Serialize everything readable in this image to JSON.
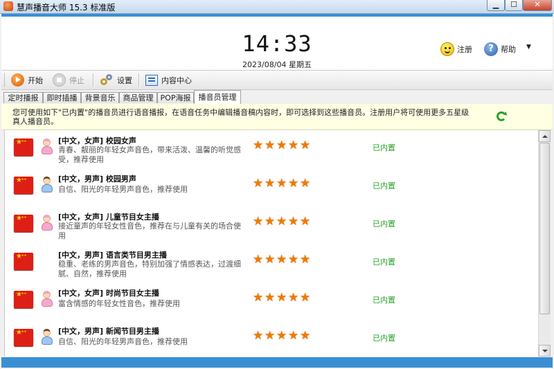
{
  "window": {
    "title": "慧声播音大师 15.3 标准版",
    "min": "▁",
    "max": "☐",
    "close": "✕"
  },
  "header": {
    "time": "14:33",
    "date": "2023/08/04 星期五",
    "register_label": "注册",
    "help_label": "帮助",
    "caret": "▼"
  },
  "toolbar": {
    "start_label": "开始",
    "stop_label": "停止",
    "settings_label": "设置",
    "content_label": "内容中心"
  },
  "tabs": [
    {
      "label": "定时播报"
    },
    {
      "label": "即时插播"
    },
    {
      "label": "背景音乐"
    },
    {
      "label": "商品管理"
    },
    {
      "label": "POP海报"
    },
    {
      "label": "播音员管理",
      "active": true
    }
  ],
  "notice": {
    "text": "您可使用如下\"已内置\"的播音员进行语音播报，在语音任务中编辑播音稿内容时，即可选择到这些播音员。注册用户将可使用更多五星级真人播音员。"
  },
  "announcers": [
    {
      "title": "[中文，女声] 校园女声",
      "desc": "青春、靓丽的年轻女声音色，带来活泼、温馨的听觉感受，推荐使用",
      "gender": "female",
      "rating": 5,
      "status": "已内置"
    },
    {
      "title": "[中文，男声] 校园男声",
      "desc": "自信、阳光的年轻男声音色，推荐使用",
      "gender": "male",
      "rating": 5,
      "status": "已内置"
    },
    {
      "title": "[中文，女声] 儿童节目女主播",
      "desc": "接近童声的年轻女性音色，推荐在与儿童有关的场合使用",
      "gender": "female",
      "rating": 5,
      "status": "已内置"
    },
    {
      "title": "[中文，男声] 语言类节目男主播",
      "desc": "稳重、老练的男声音色，特别加强了情感表达，过渡细腻、自然，推荐使用",
      "gender": "none",
      "rating": 5,
      "status": "已内置"
    },
    {
      "title": "[中文，女声] 时尚节目女主播",
      "desc": "富含情感的年轻女性音色，推荐使用",
      "gender": "female",
      "rating": 5,
      "status": "已内置"
    },
    {
      "title": "[中文，男声] 新闻节目男主播",
      "desc": "自信、阳光的年轻男声音色，推荐使用",
      "gender": "male",
      "rating": 5,
      "status": "已内置"
    }
  ],
  "colors": {
    "accent": "#3a8fd4",
    "star": "#f07a00",
    "status_green": "#27a327",
    "notice_bg": "#ffffe4"
  }
}
